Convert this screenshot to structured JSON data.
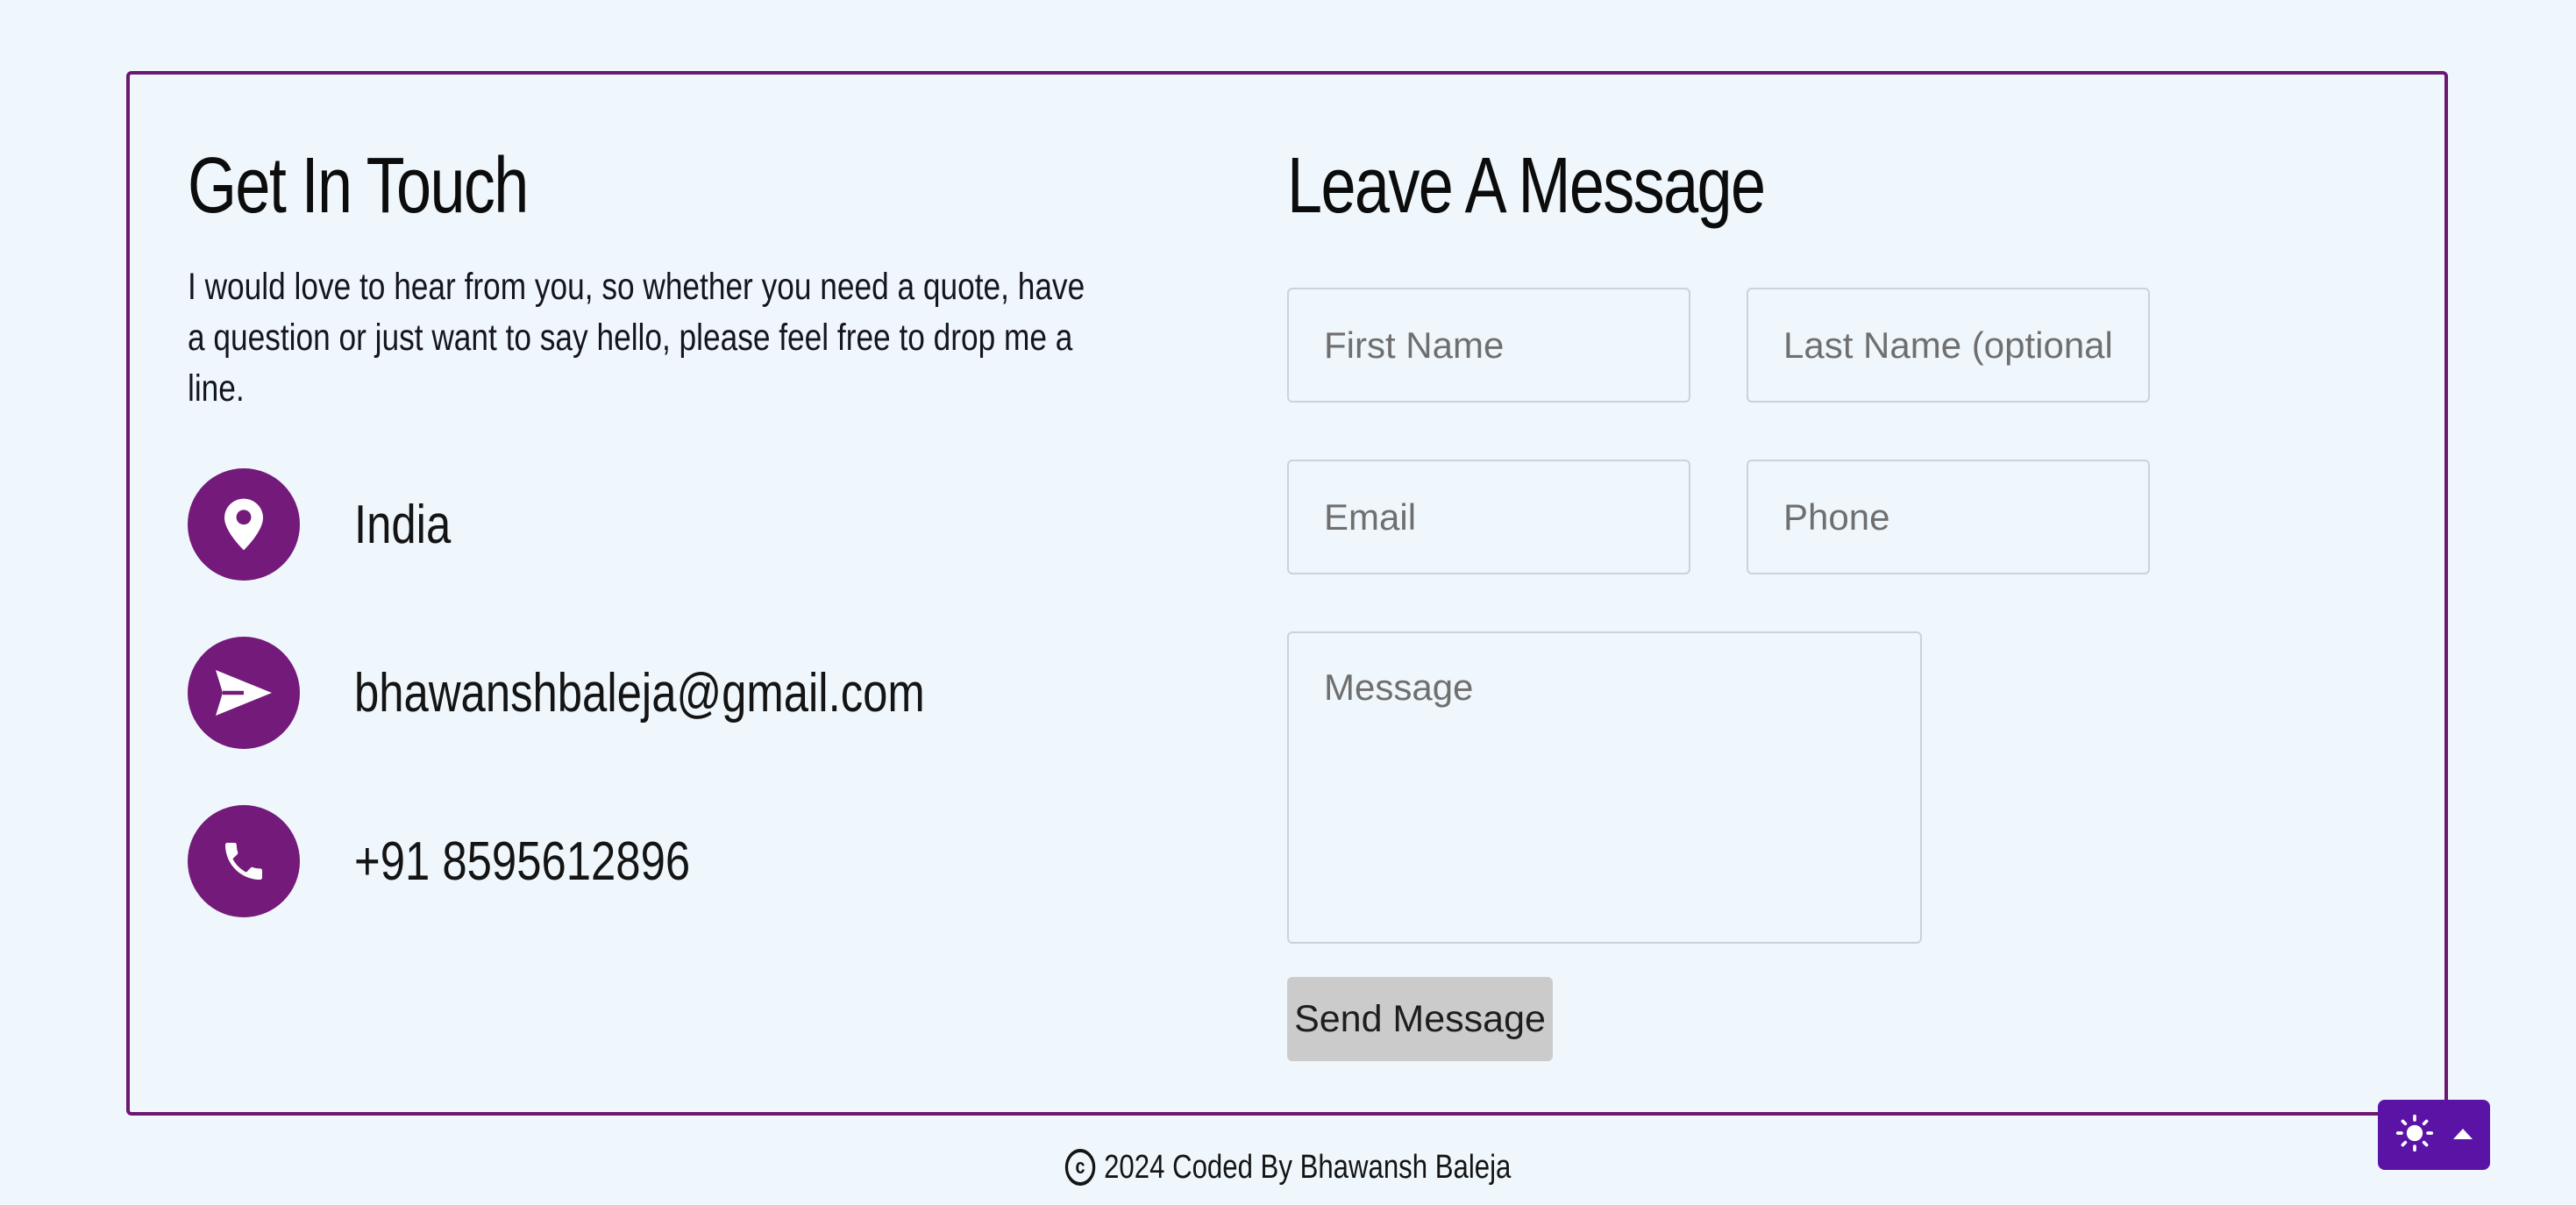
{
  "contact": {
    "heading": "Get In Touch",
    "intro": "I would love to hear from you, so whether you need a quote, have a question or just want to say hello, please feel free to drop me a line.",
    "items": [
      {
        "icon": "location-pin-icon",
        "text": "India"
      },
      {
        "icon": "send-icon",
        "text": "bhawanshbaleja@gmail.com"
      },
      {
        "icon": "phone-icon",
        "text": "+91 8595612896"
      }
    ]
  },
  "form": {
    "heading": "Leave A Message",
    "first_name_placeholder": "First Name",
    "last_name_placeholder": "Last Name (optional)",
    "email_placeholder": "Email",
    "phone_placeholder": "Phone",
    "message_placeholder": "Message",
    "submit_label": "Send Message"
  },
  "footer": {
    "copyright_symbol": "c",
    "text": "2024 Coded By Bhawansh Baleja"
  },
  "theme_toggle": {
    "icons": [
      "sun-icon",
      "caret-up-icon"
    ]
  },
  "colors": {
    "background": "#eff7fc",
    "accent": "#731a7a",
    "border": "#6c1870",
    "toggle": "#5b13a6",
    "button": "#cbcbcb"
  }
}
